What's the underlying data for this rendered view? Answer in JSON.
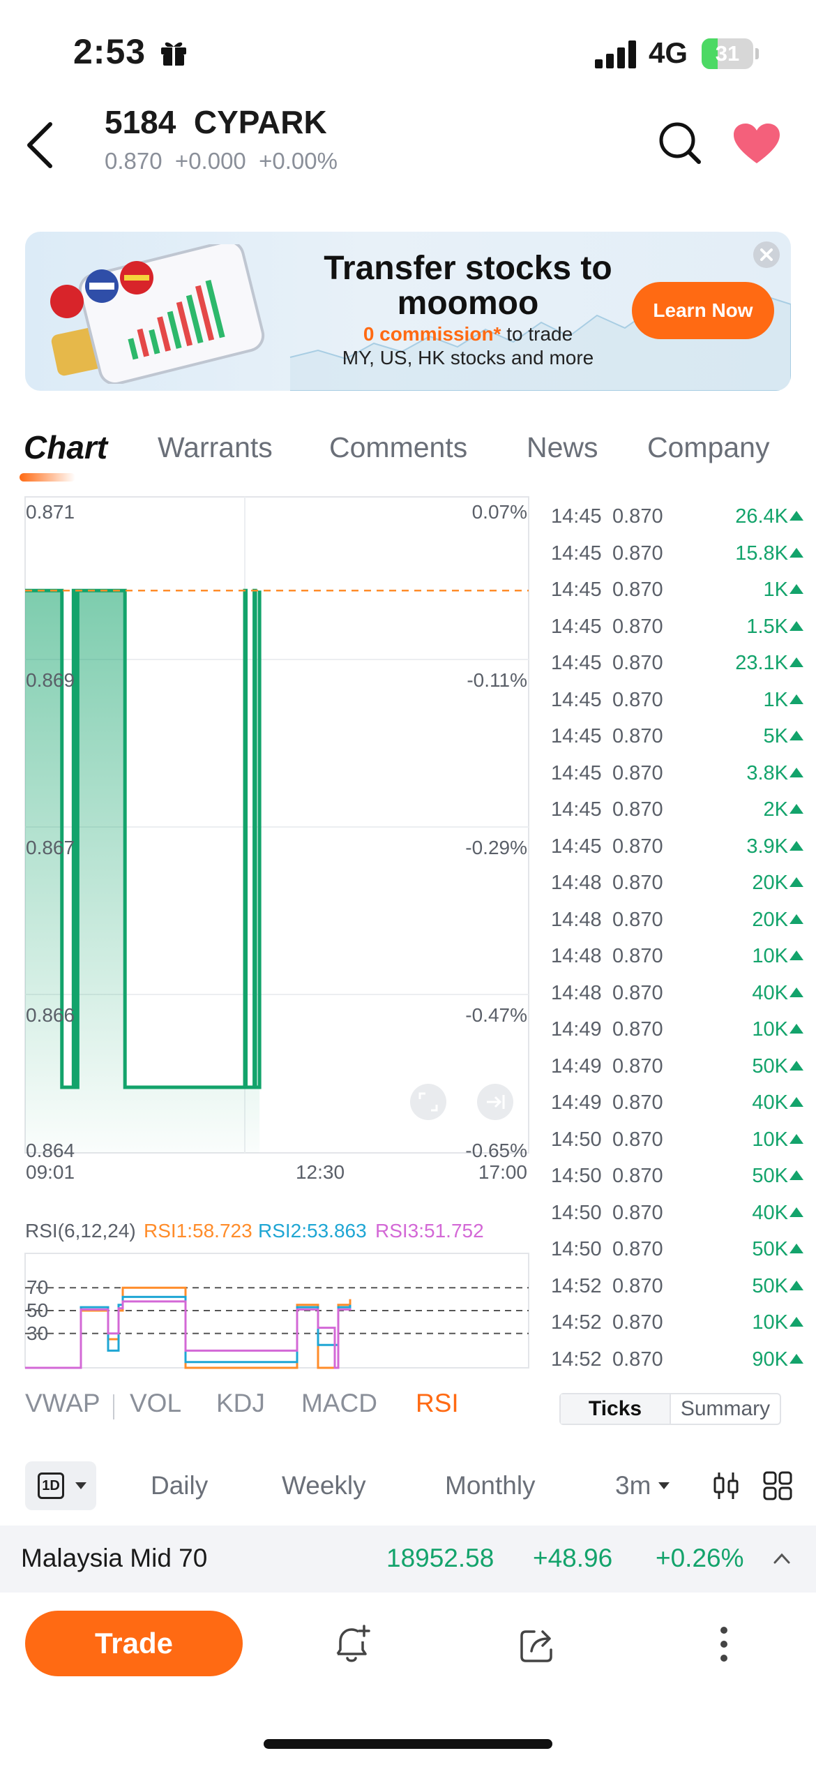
{
  "status_bar": {
    "time": "2:53",
    "network": "4G",
    "battery_level": "31",
    "battery_fraction": 0.31,
    "icons": [
      "gift-icon",
      "signal-icon",
      "battery-icon"
    ]
  },
  "header": {
    "title": "5184  CYPARK",
    "quote": "0.870  +0.000  +0.00%",
    "icons": [
      "back-icon",
      "search-icon",
      "heart-icon"
    ]
  },
  "banner": {
    "title": "Transfer stocks to moomoo",
    "subtitle_highlight": "0 commission*",
    "subtitle_rest": " to trade",
    "subtitle_line2": "MY, US, HK stocks and more",
    "button": "Learn Now",
    "brand_color": "#ff6a13"
  },
  "tabs": [
    {
      "label": "Chart",
      "active": true
    },
    {
      "label": "Warrants",
      "active": false
    },
    {
      "label": "Comments",
      "active": false
    },
    {
      "label": "News",
      "active": false
    },
    {
      "label": "Company",
      "active": false
    }
  ],
  "chart_data": [
    {
      "type": "area",
      "y_tick_labels": [
        "0.871",
        "0.869",
        "0.867",
        "0.866",
        "0.864"
      ],
      "right_tick_labels": [
        "0.07%",
        "-0.11%",
        "-0.29%",
        "-0.47%",
        "-0.65%"
      ],
      "x_tick_labels": [
        "09:01",
        "12:30",
        "17:00"
      ],
      "ylim": [
        0.864,
        0.871
      ],
      "reference_price": 0.87,
      "x": [
        "09:01",
        "09:35",
        "09:36",
        "09:47",
        "09:48",
        "09:50",
        "09:51",
        "09:53",
        "09:54",
        "10:35",
        "10:36",
        "12:30",
        "12:31",
        "12:39",
        "12:40",
        "12:44"
      ],
      "values": [
        0.87,
        0.87,
        0.8647,
        0.87,
        0.8647,
        0.8647,
        0.87,
        0.87,
        0.87,
        0.87,
        0.8647,
        0.87,
        0.8647,
        0.87,
        0.8647,
        0.87
      ],
      "series_color": "#13a36b",
      "reference_color": "#ff8c2a"
    },
    {
      "type": "line",
      "title": "RSI(6,12,24)",
      "y_tick_labels": [
        "70",
        "50",
        "30"
      ],
      "ylim": [
        0,
        100
      ],
      "reference_lines": [
        70,
        50,
        30
      ],
      "series": [
        {
          "name": "RSI1:58.723",
          "color": "#ff8c2a",
          "values": [
            0,
            0,
            50,
            50,
            25,
            50,
            70,
            70,
            0,
            55,
            55,
            55,
            0,
            0,
            55,
            55,
            60
          ]
        },
        {
          "name": "RSI2:53.863",
          "color": "#1fa6d4",
          "values": [
            0,
            0,
            53,
            53,
            15,
            55,
            62,
            62,
            5,
            53,
            53,
            53,
            20,
            20,
            53,
            53,
            55
          ]
        },
        {
          "name": "RSI3:51.752",
          "color": "#d368d6",
          "values": [
            0,
            0,
            51,
            51,
            30,
            52,
            58,
            58,
            15,
            51,
            51,
            51,
            35,
            0,
            51,
            51,
            52
          ]
        }
      ]
    }
  ],
  "ticks": [
    {
      "time": "14:45",
      "price": "0.870",
      "vol": "26.4K"
    },
    {
      "time": "14:45",
      "price": "0.870",
      "vol": "15.8K"
    },
    {
      "time": "14:45",
      "price": "0.870",
      "vol": "1K"
    },
    {
      "time": "14:45",
      "price": "0.870",
      "vol": "1.5K"
    },
    {
      "time": "14:45",
      "price": "0.870",
      "vol": "23.1K"
    },
    {
      "time": "14:45",
      "price": "0.870",
      "vol": "1K"
    },
    {
      "time": "14:45",
      "price": "0.870",
      "vol": "5K"
    },
    {
      "time": "14:45",
      "price": "0.870",
      "vol": "3.8K"
    },
    {
      "time": "14:45",
      "price": "0.870",
      "vol": "2K"
    },
    {
      "time": "14:45",
      "price": "0.870",
      "vol": "3.9K"
    },
    {
      "time": "14:48",
      "price": "0.870",
      "vol": "20K"
    },
    {
      "time": "14:48",
      "price": "0.870",
      "vol": "20K"
    },
    {
      "time": "14:48",
      "price": "0.870",
      "vol": "10K"
    },
    {
      "time": "14:48",
      "price": "0.870",
      "vol": "40K"
    },
    {
      "time": "14:49",
      "price": "0.870",
      "vol": "10K"
    },
    {
      "time": "14:49",
      "price": "0.870",
      "vol": "50K"
    },
    {
      "time": "14:49",
      "price": "0.870",
      "vol": "40K"
    },
    {
      "time": "14:50",
      "price": "0.870",
      "vol": "10K"
    },
    {
      "time": "14:50",
      "price": "0.870",
      "vol": "50K"
    },
    {
      "time": "14:50",
      "price": "0.870",
      "vol": "40K"
    },
    {
      "time": "14:50",
      "price": "0.870",
      "vol": "50K"
    },
    {
      "time": "14:52",
      "price": "0.870",
      "vol": "50K"
    },
    {
      "time": "14:52",
      "price": "0.870",
      "vol": "10K"
    },
    {
      "time": "14:52",
      "price": "0.870",
      "vol": "90K"
    }
  ],
  "indicators": {
    "items": [
      "VWAP",
      "VOL",
      "KDJ",
      "MACD",
      "RSI"
    ],
    "active": "RSI",
    "toggle": {
      "ticks": "Ticks",
      "summary": "Summary"
    }
  },
  "periods": {
    "intraday": "1D",
    "items": [
      "Daily",
      "Weekly",
      "Monthly",
      "3m"
    ],
    "icons": [
      "candlestick-icon",
      "grid-icon"
    ]
  },
  "index_bar": {
    "name": "Malaysia Mid 70",
    "value": "18952.58",
    "change": "+48.96",
    "percent": "+0.26%"
  },
  "bottom_bar": {
    "trade": "Trade",
    "icons": [
      "alert-icon",
      "share-icon",
      "more-icon"
    ]
  },
  "colors": {
    "accent": "#ff6a13",
    "up": "#13a36b",
    "muted": "#8a8f99"
  }
}
